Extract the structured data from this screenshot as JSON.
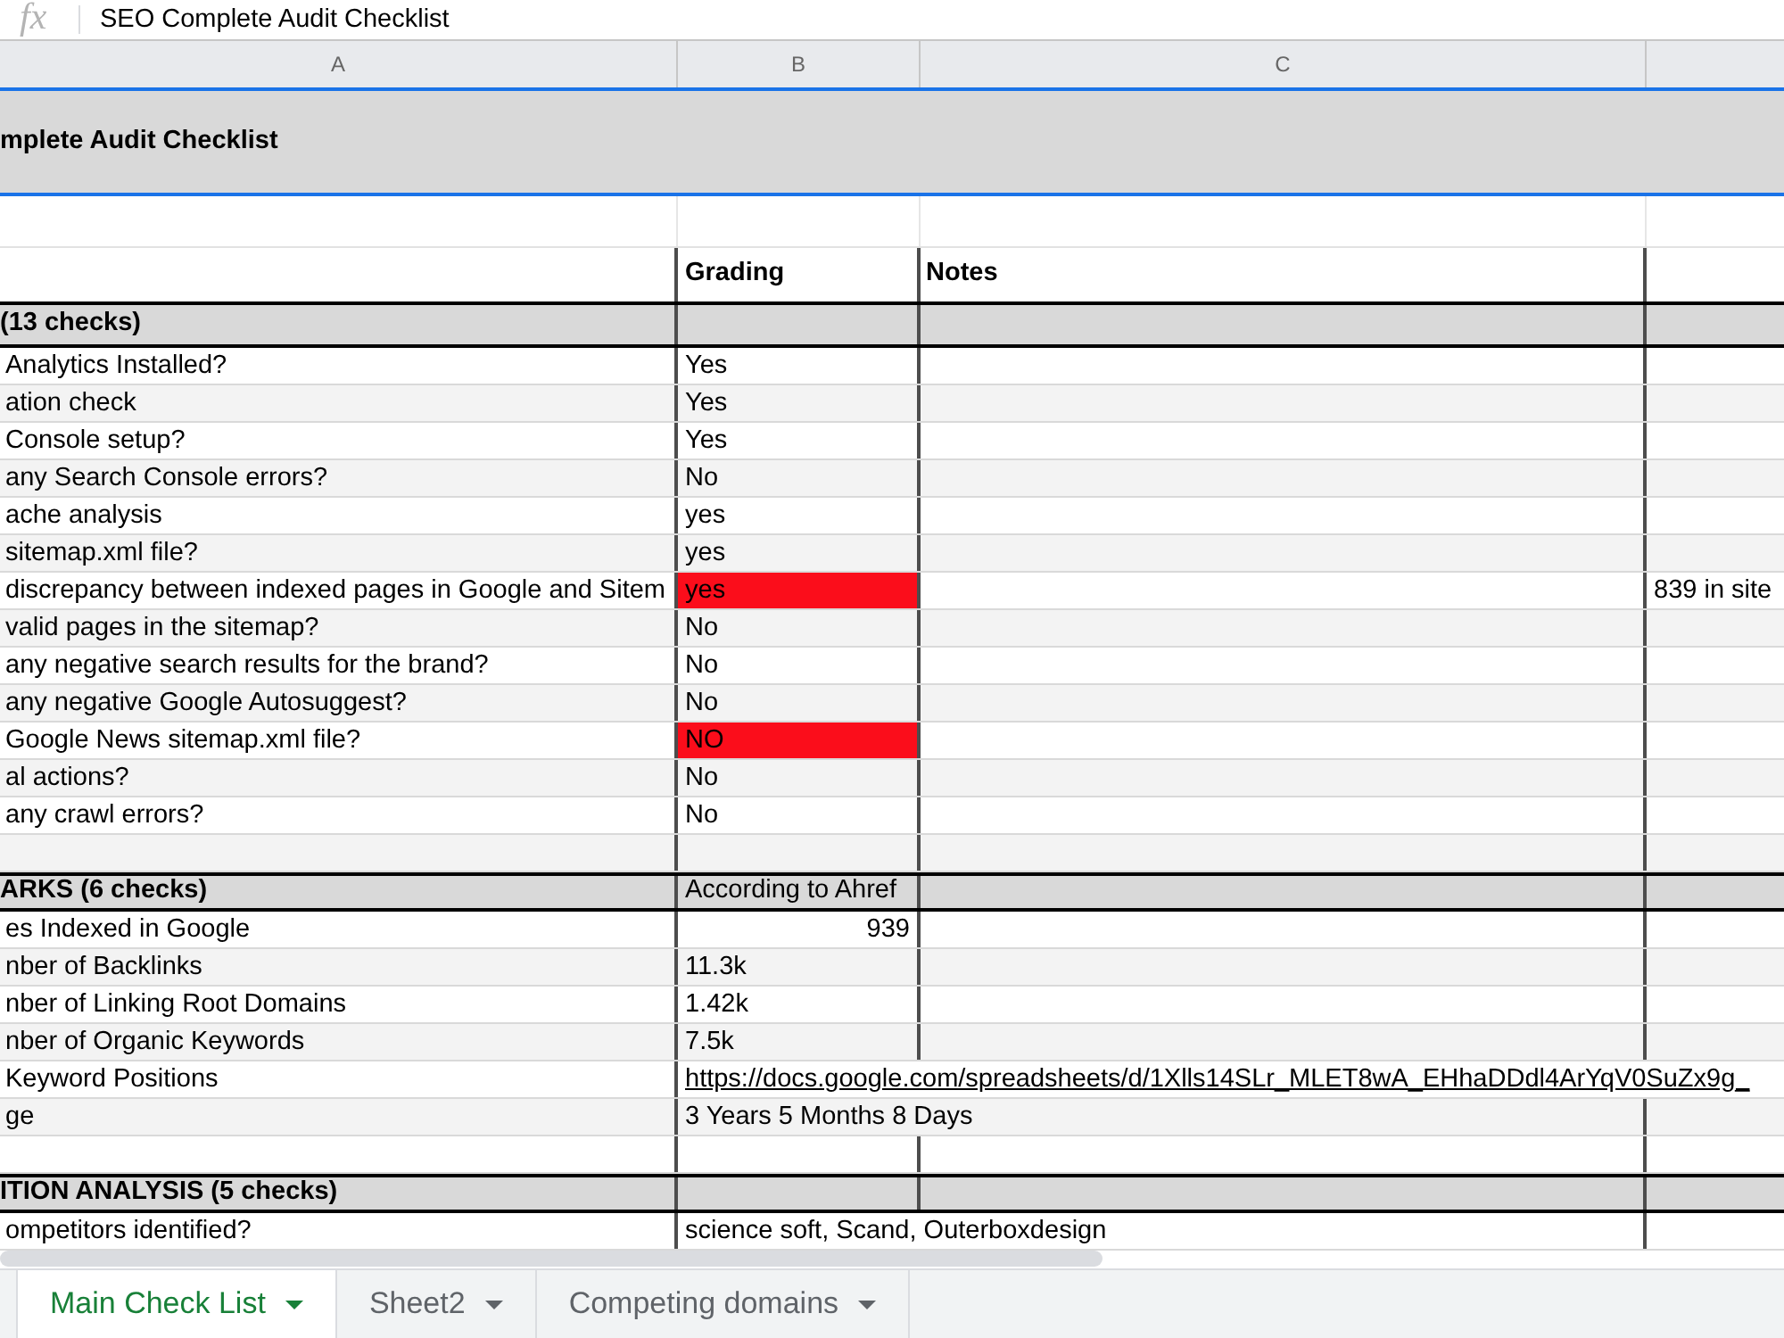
{
  "formula_bar": {
    "label": "fx",
    "content": "SEO Complete Audit Checklist"
  },
  "column_headers": [
    "A",
    "B",
    "C"
  ],
  "title": {
    "text": "mplete Audit Checklist",
    "selected": true
  },
  "table_header": {
    "grading": "Grading",
    "notes": "Notes"
  },
  "sections": [
    {
      "heading": "(13 checks)",
      "rows": [
        {
          "check": "Analytics Installed?",
          "grading": {
            "text": "Yes",
            "kind": "text",
            "flagged": false
          }
        },
        {
          "check": "ation check",
          "grading": {
            "text": "Yes",
            "kind": "text",
            "flagged": false
          }
        },
        {
          "check": "Console setup?",
          "grading": {
            "text": "Yes",
            "kind": "text",
            "flagged": false
          }
        },
        {
          "check": "any Search Console errors?",
          "grading": {
            "text": "No",
            "kind": "text",
            "flagged": false
          }
        },
        {
          "check": "ache analysis",
          "grading": {
            "text": "yes",
            "kind": "text",
            "flagged": false
          }
        },
        {
          "check": "sitemap.xml file?",
          "grading": {
            "text": "yes",
            "kind": "text",
            "flagged": false
          }
        },
        {
          "check": "discrepancy between indexed pages in Google and Sitem",
          "grading": {
            "text": "yes",
            "kind": "text",
            "flagged": true
          },
          "column_4": "839 in site"
        },
        {
          "check": "valid pages in the sitemap?",
          "grading": {
            "text": "No",
            "kind": "text",
            "flagged": false
          }
        },
        {
          "check": "any negative search results for the brand?",
          "grading": {
            "text": "No",
            "kind": "text",
            "flagged": false
          }
        },
        {
          "check": "any negative Google Autosuggest?",
          "grading": {
            "text": "No",
            "kind": "text",
            "flagged": false
          }
        },
        {
          "check": "Google News sitemap.xml file?",
          "grading": {
            "text": "NO",
            "kind": "text",
            "flagged": true
          }
        },
        {
          "check": "al actions?",
          "grading": {
            "text": "No",
            "kind": "text",
            "flagged": false
          }
        },
        {
          "check": "any crawl errors?",
          "grading": {
            "text": "No",
            "kind": "text",
            "flagged": false
          }
        }
      ]
    },
    {
      "heading": "ARKS (6 checks)",
      "grading_heading": "According to Ahref",
      "rows": [
        {
          "check": "es Indexed in Google",
          "grading": {
            "text": "939",
            "kind": "number",
            "flagged": false
          }
        },
        {
          "check": "nber of Backlinks",
          "grading": {
            "text": "11.3k",
            "kind": "text",
            "flagged": false
          }
        },
        {
          "check": "nber of Linking Root Domains",
          "grading": {
            "text": "1.42k",
            "kind": "text",
            "flagged": false
          }
        },
        {
          "check": "nber of Organic Keywords",
          "grading": {
            "text": "7.5k",
            "kind": "text",
            "flagged": false
          }
        },
        {
          "check": "Keyword Positions",
          "grading": {
            "text": "https://docs.google.com/spreadsheets/d/1Xlls14SLr_MLET8wA_EHhaDDdl4ArYqV0SuZx9g_",
            "kind": "link",
            "flagged": false
          }
        },
        {
          "check": "ge",
          "grading": {
            "text": "3 Years 5 Months 8 Days",
            "kind": "text",
            "flagged": false
          }
        }
      ]
    },
    {
      "heading": "ITION ANALYSIS (5 checks)",
      "rows": [
        {
          "check": "ompetitors identified?",
          "grading": {
            "text": "science soft, Scand, Outerboxdesign",
            "kind": "text",
            "flagged": false
          }
        }
      ]
    }
  ],
  "tabs": [
    {
      "label": "Main Check List",
      "selected": true
    },
    {
      "label": "Sheet2",
      "selected": false
    },
    {
      "label": "Competing domains",
      "selected": false
    }
  ]
}
